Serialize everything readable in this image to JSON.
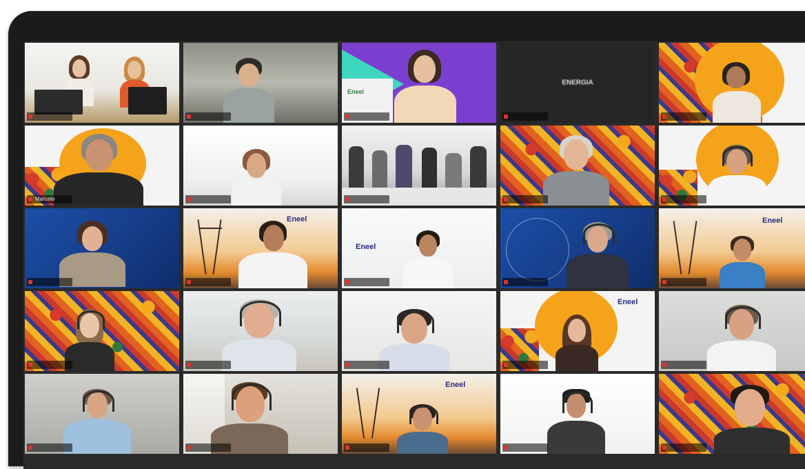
{
  "meeting": {
    "placeholder_tile_name": "ENERGIA"
  },
  "participants": [
    {
      "name": ""
    },
    {
      "name": ""
    },
    {
      "name": ""
    },
    {
      "name": ""
    },
    {
      "name": ""
    },
    {
      "name": "Marcelo"
    },
    {
      "name": ""
    },
    {
      "name": ""
    },
    {
      "name": ""
    },
    {
      "name": ""
    },
    {
      "name": ""
    },
    {
      "name": ""
    },
    {
      "name": ""
    },
    {
      "name": ""
    },
    {
      "name": ""
    },
    {
      "name": ""
    },
    {
      "name": ""
    },
    {
      "name": ""
    },
    {
      "name": ""
    },
    {
      "name": ""
    },
    {
      "name": ""
    },
    {
      "name": ""
    },
    {
      "name": ""
    },
    {
      "name": ""
    },
    {
      "name": ""
    }
  ],
  "branding": {
    "logo_text": "Eneel"
  },
  "colors": {
    "active_speaker_border": "#86c440",
    "muted_mic": "#e0332e",
    "brand_orange": "#f5a31a",
    "brand_purple": "#6a2ba6",
    "brand_teal": "#3fd6c0"
  },
  "icons": {
    "mic": "microphone-muted-icon"
  }
}
